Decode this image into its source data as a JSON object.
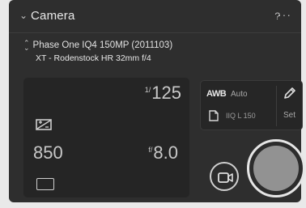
{
  "header": {
    "title": "Camera",
    "collapse_icon": "chevron-down-icon",
    "help_label": "?",
    "more_label": "···"
  },
  "camera": {
    "name": "Phase One IQ4 150MP (2011103)",
    "lens": "XT - Rodenstock HR 32mm f/4"
  },
  "exposure": {
    "shutter_prefix": "1/",
    "shutter_value": "125",
    "iso_value": "850",
    "aperture_prefix": "f/",
    "aperture_value": "8.0",
    "exposure_icon": "exposure-compensation-icon",
    "frame_icon": "frame-icon"
  },
  "settings": {
    "awb_icon_label": "AWB",
    "awb_value": "Auto",
    "file_format": "IIQ L 150",
    "set_label": "Set",
    "pen_icon": "pencil-icon",
    "file_icon": "file-icon"
  },
  "buttons": {
    "video_icon": "video-camera-icon",
    "capture_icon": "capture-shutter-icon"
  },
  "colors": {
    "panel_bg": "#2e2e2e",
    "card_bg": "#252525",
    "capture_fill": "#929292"
  }
}
